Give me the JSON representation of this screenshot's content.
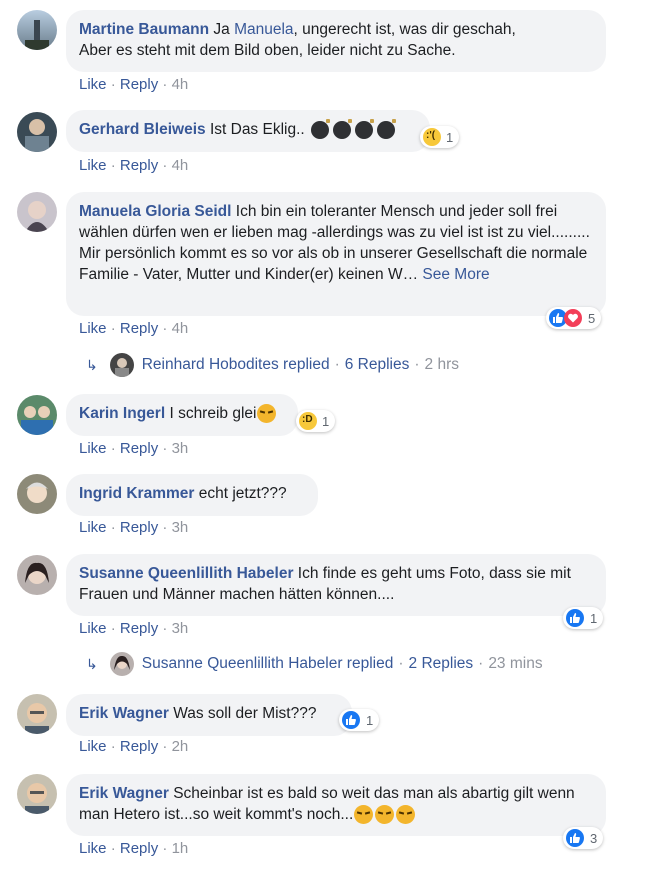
{
  "actions": {
    "like": "Like",
    "reply": "Reply",
    "sep": "·"
  },
  "comments": [
    {
      "author": "Martine Baumann",
      "text_a": "Ja ",
      "mention": "Manuela",
      "text_b": ", ungerecht ist, was dir geschah,",
      "text_c": "Aber es steht mit dem Bild oben, leider nicht zu Sache.",
      "time": "4h"
    },
    {
      "author": "Gerhard Bleiweis",
      "text": "Ist Das Eklig..",
      "time": "4h",
      "reaction_count": "1",
      "reaction_icon": "sad-emoji-icon"
    },
    {
      "author": "Manuela Gloria Seidl",
      "text": "Ich bin ein toleranter Mensch und jeder soll frei wählen dürfen wen er lieben mag -allerdings was zu viel ist ist zu viel......... Mir persönlich kommt es so vor als ob in unserer Gesellschaft die normale Familie - Vater, Mutter und Kinder(er) keinen W…",
      "see_more": "See More",
      "time": "4h",
      "reaction_count": "5",
      "replied_name": "Reinhard Hobodites replied",
      "replies": "6 Replies",
      "replies_time": "2 hrs"
    },
    {
      "author": "Karin Ingerl",
      "text": "I schreib glei",
      "time": "3h",
      "reaction_count": "1"
    },
    {
      "author": "Ingrid Krammer",
      "text": "echt jetzt???",
      "time": "3h"
    },
    {
      "author": "Susanne Queenlillith Habeler",
      "text": "Ich finde es geht ums Foto, dass sie mit Frauen und Männer machen hätten können....",
      "time": "3h",
      "reaction_count": "1",
      "replied_name": "Susanne Queenlillith Habeler replied",
      "replies": "2 Replies",
      "replies_time": "23 mins"
    },
    {
      "author": "Erik Wagner",
      "text": "Was soll der Mist???",
      "time": "2h",
      "reaction_count": "1"
    },
    {
      "author": "Erik Wagner",
      "text": "Scheinbar ist es bald so weit das man als abartig gilt wenn man Hetero ist...so weit kommt's noch...",
      "time": "1h",
      "reaction_count": "3"
    }
  ],
  "colors": {
    "link": "#385898",
    "bubble": "#f2f3f5",
    "meta": "#90949c",
    "like_blue": "#1877f2",
    "love_red": "#f33e58"
  }
}
